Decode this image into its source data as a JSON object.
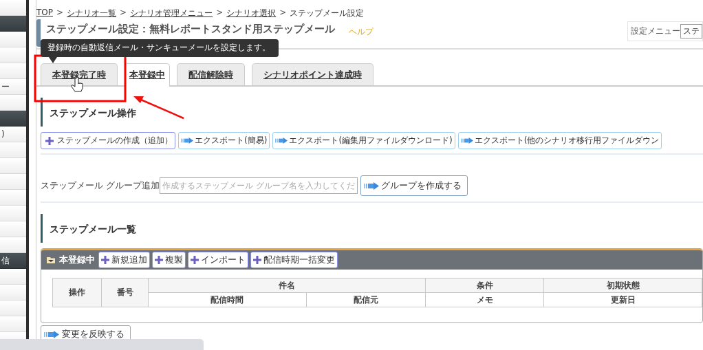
{
  "sidebar": {
    "items": [
      {
        "kind": "item"
      },
      {
        "kind": "header"
      },
      {
        "kind": "item"
      },
      {
        "kind": "item"
      },
      {
        "kind": "item"
      },
      {
        "kind": "item",
        "label": "ー"
      },
      {
        "kind": "item"
      },
      {
        "kind": "header"
      },
      {
        "kind": "item",
        "label": ")"
      },
      {
        "kind": "item"
      },
      {
        "kind": "item"
      },
      {
        "kind": "item"
      },
      {
        "kind": "item"
      },
      {
        "kind": "item"
      },
      {
        "kind": "item"
      },
      {
        "kind": "item"
      },
      {
        "kind": "header",
        "label": "信"
      },
      {
        "kind": "item"
      },
      {
        "kind": "item"
      },
      {
        "kind": "item"
      },
      {
        "kind": "item"
      },
      {
        "kind": "item"
      }
    ]
  },
  "breadcrumb": [
    {
      "kind": "link",
      "label": "TOP"
    },
    {
      "kind": "separator",
      "label": ">"
    },
    {
      "kind": "link",
      "label": "シナリオ一覧"
    },
    {
      "kind": "separator",
      "label": ">"
    },
    {
      "kind": "link",
      "label": "シナリオ管理メニュー"
    },
    {
      "kind": "separator",
      "label": ">"
    },
    {
      "kind": "link",
      "label": "シナリオ選択"
    },
    {
      "kind": "separator",
      "label": ">"
    },
    {
      "kind": "current",
      "label": "ステップメール設定"
    }
  ],
  "page_title": "ステップメール設定：無料レポートスタンド用ステップメール",
  "help_link": "ヘルプ",
  "settings_menu": {
    "label": "設定メニュー",
    "value": "ステ"
  },
  "tooltip": "登録時の自動返信メール・サンキューメールを設定します。",
  "tabs": [
    {
      "label": "本登録完了時",
      "selected": false
    },
    {
      "label": "本登録中",
      "selected": true
    },
    {
      "label": "配信解除時",
      "selected": false
    },
    {
      "label": "シナリオポイント達成時",
      "selected": false
    }
  ],
  "operations": {
    "title": "ステップメール操作",
    "buttons": [
      {
        "kind": "add",
        "label": "ステップメールの作成（追加）"
      },
      {
        "kind": "export",
        "label": "エクスポート(簡易)"
      },
      {
        "kind": "export",
        "label": "エクスポート(編集用ファイルダウンロード)"
      },
      {
        "kind": "export",
        "label": "エクスポート(他のシナリオ移行用ファイルダウン"
      }
    ]
  },
  "group_add": {
    "label": "ステップメール グループ追加",
    "placeholder": "作成するステップメール グループ名を入力してくだ",
    "button": "グループを作成する"
  },
  "list": {
    "title": "ステップメール一覧",
    "group": {
      "name": "本登録中",
      "buttons": [
        "新規追加",
        "複製",
        "インポート",
        "配信時期一括変更"
      ]
    },
    "table": {
      "columns": [
        {
          "label": "操作"
        },
        {
          "label": "番号"
        },
        {
          "label": "件名",
          "sub": [
            "配信時間",
            "配信元"
          ]
        },
        {
          "label": "条件",
          "sub": [
            "メモ"
          ]
        },
        {
          "label": "初期状態",
          "sub": [
            "更新日"
          ]
        }
      ]
    },
    "apply_button": "変更を反映する"
  }
}
